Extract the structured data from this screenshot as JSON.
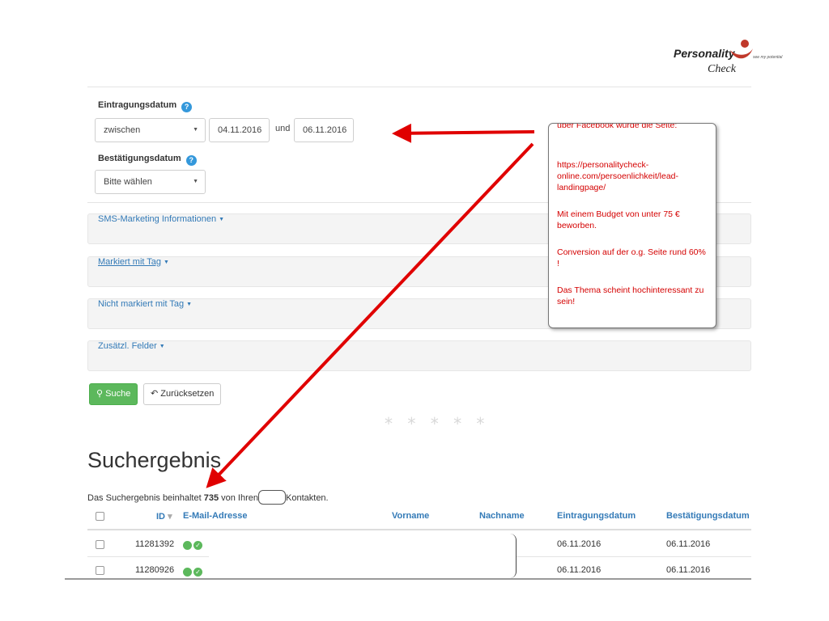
{
  "logo": {
    "line1": "Personality",
    "line2": "Check",
    "tagline": "see my potential"
  },
  "filters": {
    "entry_date_label": "Eintragungsdatum",
    "entry_date_mode": "zwischen",
    "entry_date_from": "04.11.2016",
    "between_word": "und",
    "entry_date_to": "06.11.2016",
    "confirm_date_label": "Bestätigungsdatum",
    "confirm_date_mode": "Bitte wählen",
    "help_glyph": "?",
    "sections": [
      "SMS-Marketing Informationen",
      "Markiert mit Tag",
      "Nicht markiert mit Tag",
      "Zusätzl. Felder"
    ]
  },
  "buttons": {
    "search": "Suche",
    "reset": "Zurücksetzen"
  },
  "divider_text": "* * * * *",
  "results": {
    "heading": "Suchergebnis",
    "summary_before": "Das Suchergebnis beinhaltet",
    "count": "735",
    "summary_mid": "von Ihren",
    "summary_after": "Kontakten.",
    "columns": [
      "ID",
      "E-Mail-Adresse",
      "Vorname",
      "Nachname",
      "Eintragungsdatum",
      "Bestätigungsdatum"
    ],
    "sort_indicator": "▾",
    "rows": [
      {
        "id": "11281392",
        "entry": "06.11.2016",
        "confirm": "06.11.2016"
      },
      {
        "id": "11280926",
        "entry": "06.11.2016",
        "confirm": "06.11.2016"
      }
    ]
  },
  "annotation": {
    "cut_top": "über Facebook wurde die Seite:",
    "url": "https://personalitycheck-online.com/persoenlichkeit/lead-landingpage/",
    "budget": "Mit einem Budget von unter 75 € beworben.",
    "conversion": "Conversion auf der o.g. Seite rund 60% !",
    "topic": "Das Thema scheint hochinteressant zu sein!"
  },
  "colors": {
    "accent_link": "#337ab7",
    "success": "#5cb85c",
    "annotation_red": "#d40000",
    "help_blue": "#3498db"
  }
}
